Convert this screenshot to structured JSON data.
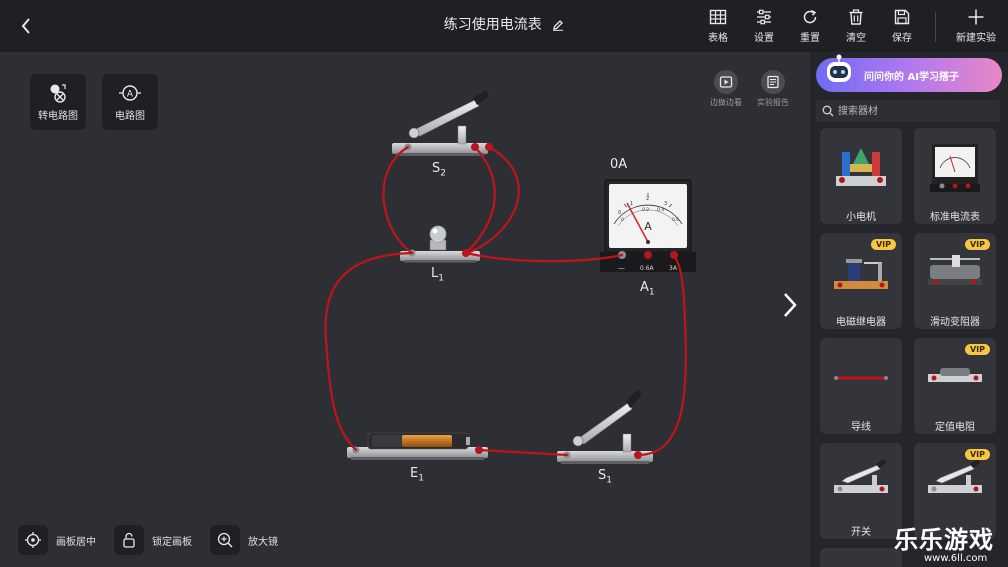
{
  "header": {
    "title": "练习使用电流表",
    "tools": [
      {
        "label": "表格",
        "icon": "table-icon"
      },
      {
        "label": "设置",
        "icon": "sliders-icon"
      },
      {
        "label": "重置",
        "icon": "reset-icon"
      },
      {
        "label": "清空",
        "icon": "trash-icon"
      },
      {
        "label": "保存",
        "icon": "save-icon"
      },
      {
        "label": "新建实验",
        "icon": "plus-icon"
      }
    ]
  },
  "canvas": {
    "left_buttons": [
      {
        "label": "转电路图",
        "icon": "convert-circuit-icon"
      },
      {
        "label": "电路图",
        "icon": "ammeter-symbol-icon"
      }
    ],
    "right_buttons": [
      {
        "label": "边做边看",
        "icon": "play-icon"
      },
      {
        "label": "实验报告",
        "icon": "report-icon"
      }
    ],
    "bottom_buttons": [
      {
        "label": "画板居中",
        "icon": "target-icon"
      },
      {
        "label": "锁定画板",
        "icon": "lock-icon"
      },
      {
        "label": "放大镜",
        "icon": "zoom-icon"
      }
    ],
    "components": {
      "s2": {
        "name": "S",
        "sub": "2"
      },
      "l1": {
        "name": "L",
        "sub": "1"
      },
      "a1": {
        "name": "A",
        "sub": "1"
      },
      "e1": {
        "name": "E",
        "sub": "1"
      },
      "s1": {
        "name": "S",
        "sub": "1"
      }
    },
    "ammeter_reading": "0A",
    "ammeter_terminals": [
      "—",
      "0.6A",
      "3A"
    ],
    "ammeter_unit": "A",
    "ammeter_scale_outer": [
      "0",
      "1",
      "2",
      "3"
    ],
    "ammeter_scale_inner": [
      "0",
      "0.2",
      "0.4",
      "0.6"
    ],
    "colors": {
      "wire": "#c0141a",
      "topbar": "#1f2024",
      "canvas": "#2e2f35",
      "panel": "#25262b",
      "vip": "#f7c744"
    }
  },
  "sidebar": {
    "banner_text": "问问你的 AI学习搭子",
    "search_placeholder": "搜索器材",
    "items": [
      {
        "label": "小电机",
        "vip": "",
        "icon": "motor-icon"
      },
      {
        "label": "标准电流表",
        "vip": "",
        "icon": "ammeter-icon"
      },
      {
        "label": "电磁继电器",
        "vip": "VIP",
        "icon": "relay-icon"
      },
      {
        "label": "滑动变阻器",
        "vip": "VIP",
        "icon": "rheostat-icon"
      },
      {
        "label": "导线",
        "vip": "",
        "icon": "wire-icon"
      },
      {
        "label": "定值电阻",
        "vip": "VIP",
        "icon": "resistor-icon"
      },
      {
        "label": "开关",
        "vip": "",
        "icon": "switch-icon"
      },
      {
        "label": "",
        "vip": "VIP",
        "icon": "switch-icon"
      }
    ]
  },
  "watermark": {
    "title": "乐乐游戏",
    "url": "www.6ll.com"
  }
}
